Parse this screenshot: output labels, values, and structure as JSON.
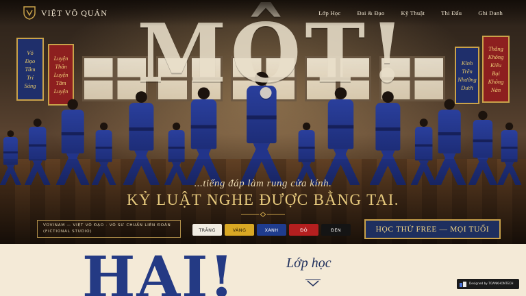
{
  "brand": {
    "name": "VIỆT VÕ QUÁN",
    "logo_icon": "shield-emblem-icon"
  },
  "nav": {
    "items": [
      "Lớp Học",
      "Đai & Đạo",
      "Kỹ Thuật",
      "Thi Đấu",
      "Ghi Danh"
    ]
  },
  "hero": {
    "headline": "MỘT!",
    "tagline": "...tiếng đáp làm rung cửa kính.",
    "subheadline": "KỶ LUẬT NGHE ĐƯỢC BẰNG TAI.",
    "banners_left": [
      {
        "lines": [
          "Võ",
          "Đạo",
          "Tâm",
          "Trí",
          "Sáng"
        ],
        "color": "#1f2f6b"
      },
      {
        "lines": [
          "Luyện",
          "Thân",
          "Luyện",
          "Tâm",
          "Luyện"
        ],
        "color": "#8d1f1f"
      }
    ],
    "banners_right": [
      {
        "lines": [
          "Kính",
          "Trên",
          "Nhường",
          "Dưới"
        ],
        "color": "#1f2f6b"
      },
      {
        "lines": [
          "Thắng",
          "Không",
          "Kiêu",
          "Bại",
          "Không",
          "Nản"
        ],
        "color": "#8d1f1f"
      }
    ],
    "org_line1": "VOVINAM — VIỆT VÕ ĐẠO · VÕ SƯ CHUẨN LIÊN ĐOÀN",
    "org_line2": "(FICTIONAL STUDIO)",
    "belts": [
      {
        "label": "TRẮNG",
        "bg": "#f1ece2",
        "fg": "#2a2a2a"
      },
      {
        "label": "VÀNG",
        "bg": "#d9a824",
        "fg": "#2a1d05"
      },
      {
        "label": "XANH",
        "bg": "#1f3c8e",
        "fg": "#ffffff"
      },
      {
        "label": "ĐỎ",
        "bg": "#b41f1f",
        "fg": "#ffffff"
      },
      {
        "label": "ĐEN",
        "bg": "#141414",
        "fg": "#ffffff"
      }
    ],
    "cta_label": "HỌC THỬ FREE — MỌI TUỔI"
  },
  "section": {
    "big_word": "HAI!",
    "title": "Lớp học"
  },
  "badge": {
    "label": "Designed by TOANKHONTECH"
  },
  "colors": {
    "accent_gold": "#c9a24a",
    "navy": "#1e2f5f",
    "cream": "#f4ead7"
  }
}
